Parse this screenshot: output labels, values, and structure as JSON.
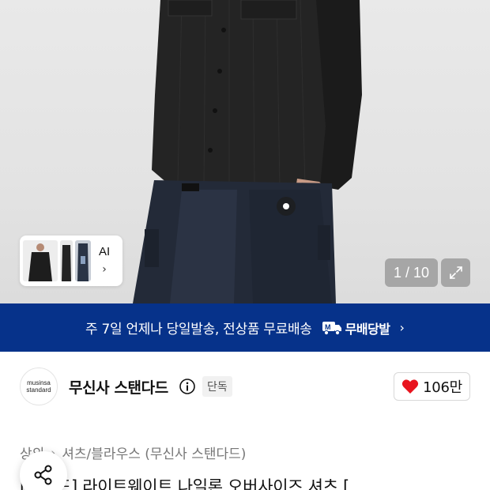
{
  "gallery": {
    "counter": "1 / 10",
    "ai_label": "AI",
    "ai_chevron": "›",
    "expand_icon": "expand-icon"
  },
  "banner": {
    "text": "주 7일 언제나 당일발송, 전상품 무료배송",
    "logo_label": "무배당발",
    "chevron": "›",
    "background": "#06328a"
  },
  "brand": {
    "logo_line1": "musinsa",
    "logo_line2": "standard",
    "name": "무신사 스탠다드",
    "badge": "단독"
  },
  "like": {
    "count": "106만",
    "heart_color": "#e8141e"
  },
  "breadcrumb": {
    "items": [
      "상의",
      "셔츠/블라우스 (무신사 스탠다드)"
    ],
    "separator": "›"
  },
  "product": {
    "title": "[레전드] 라이트웨이트 나일론 오버사이즈 셔츠 ["
  }
}
